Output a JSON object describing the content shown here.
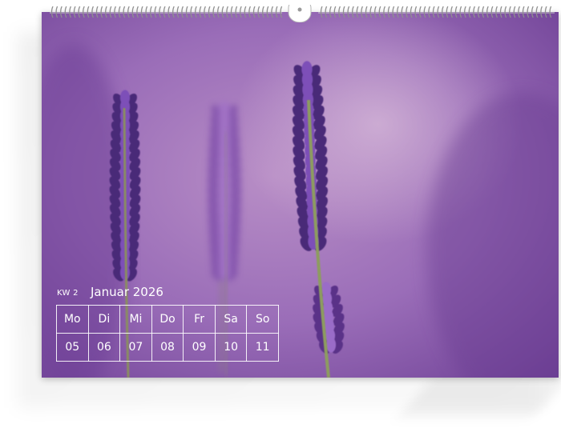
{
  "calendar": {
    "week_label": "KW 2",
    "month": "Januar 2026",
    "weekdays": [
      "Mo",
      "Di",
      "Mi",
      "Do",
      "Fr",
      "Sa",
      "So"
    ],
    "days": [
      "05",
      "06",
      "07",
      "08",
      "09",
      "10",
      "11"
    ]
  },
  "colors": {
    "photo_base": "#8a5fae",
    "lavender_dark": "#4a2a78",
    "lavender_mid": "#7d4fb8",
    "stem": "#7d8a55"
  }
}
